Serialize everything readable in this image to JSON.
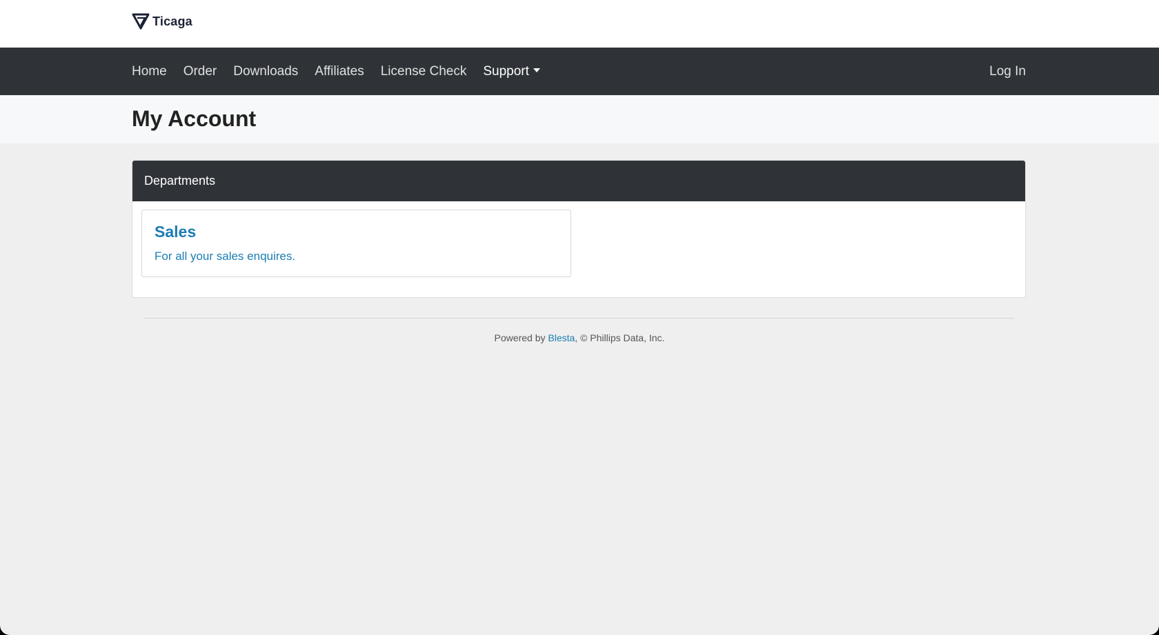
{
  "brand": {
    "name": "Ticaga",
    "logo_icon": "ticaga-logo-icon"
  },
  "nav": {
    "items": [
      {
        "label": "Home"
      },
      {
        "label": "Order"
      },
      {
        "label": "Downloads"
      },
      {
        "label": "Affiliates"
      },
      {
        "label": "License Check"
      },
      {
        "label": "Support",
        "dropdown": true
      }
    ],
    "login_label": "Log In"
  },
  "page": {
    "title": "My Account"
  },
  "departments": {
    "header": "Departments",
    "items": [
      {
        "name": "Sales",
        "description": "For all your sales enquires."
      }
    ]
  },
  "footer": {
    "prefix": "Powered by ",
    "link_text": "Blesta",
    "suffix": ", © Phillips Data, Inc."
  },
  "colors": {
    "navbar_bg": "#2f3337",
    "accent_link": "#1b7db3",
    "page_bg": "#efefef"
  }
}
